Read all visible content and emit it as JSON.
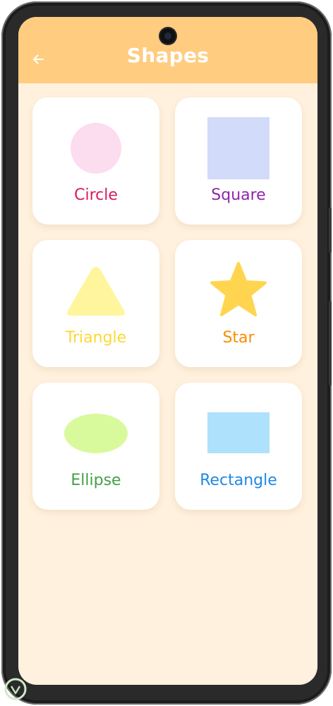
{
  "app_bar": {
    "title": "Shapes",
    "back_icon": "arrow-left-icon",
    "color": "#ffcc80"
  },
  "background_color": "#fff1de",
  "shapes": [
    {
      "label": "Circle",
      "icon": "circle-icon",
      "color": "#fcdcef",
      "label_color": "#d81b60"
    },
    {
      "label": "Square",
      "icon": "square-icon",
      "color": "#d3dbfb",
      "label_color": "#8e24aa"
    },
    {
      "label": "Triangle",
      "icon": "triangle-icon",
      "color": "#fff59d",
      "label_color": "#fdd835"
    },
    {
      "label": "Star",
      "icon": "star-icon",
      "color": "#ffd54f",
      "label_color": "#fb8c00"
    },
    {
      "label": "Ellipse",
      "icon": "ellipse-icon",
      "color": "#d9f99d",
      "label_color": "#43a047"
    },
    {
      "label": "Rectangle",
      "icon": "rectangle-icon",
      "color": "#aee1fc",
      "label_color": "#1e88e5"
    }
  ]
}
